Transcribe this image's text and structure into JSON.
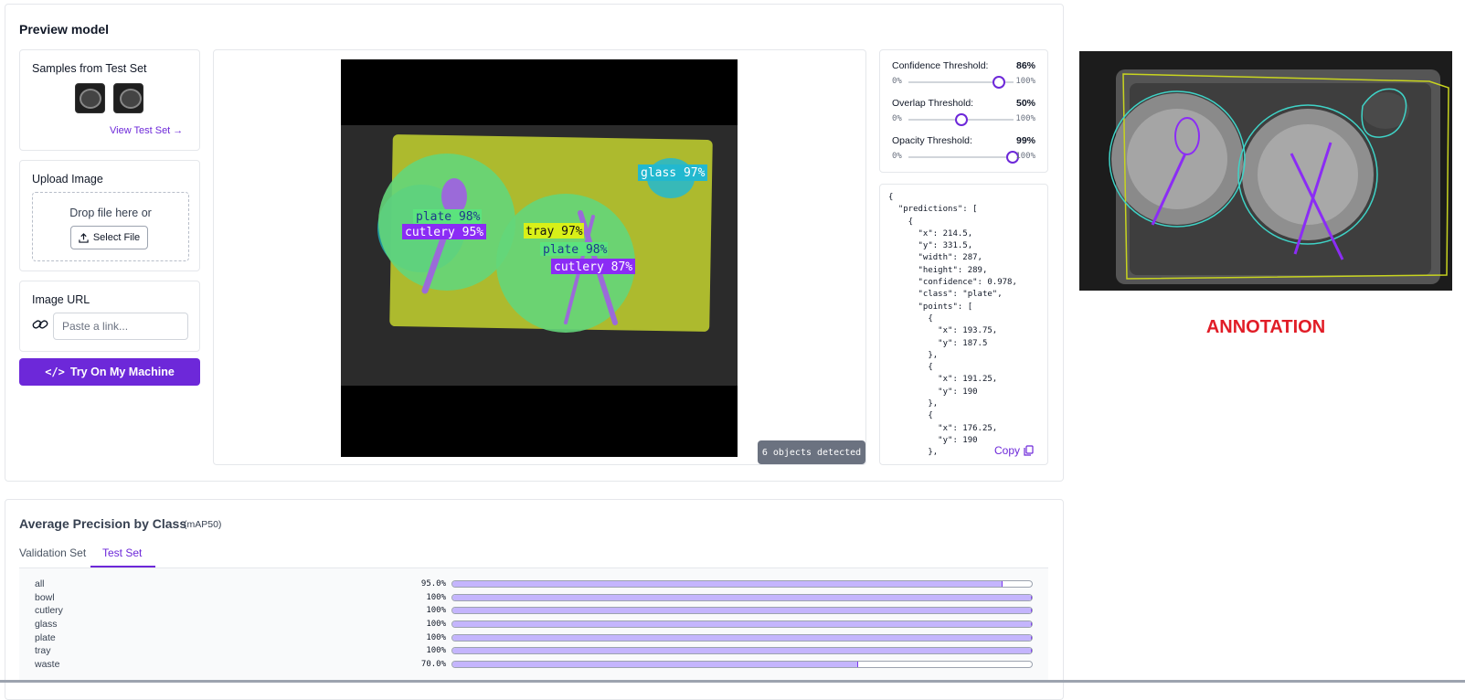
{
  "preview": {
    "title": "Preview model",
    "samples_label": "Samples from Test Set",
    "view_test_set": "View Test Set →",
    "upload_label": "Upload Image",
    "drop_text": "Drop file here or",
    "select_file": "Select File",
    "url_label": "Image URL",
    "url_placeholder": "Paste a link...",
    "try_button": "Try On My Machine",
    "objects_detected": "6 objects detected",
    "detections": [
      {
        "label": "glass 97%",
        "color": "#22b8cf"
      },
      {
        "label": "plate 98%",
        "color": "#5be37d"
      },
      {
        "label": "cutlery 95%",
        "color": "#8b2cf5"
      },
      {
        "label": "tray 97%",
        "color": "#d9f018"
      },
      {
        "label": "plate 98%",
        "color": "#5be37d"
      },
      {
        "label": "cutlery 87%",
        "color": "#8b2cf5"
      }
    ]
  },
  "thresholds": [
    {
      "label": "Confidence Threshold:",
      "value": "86%",
      "min": "0%",
      "max": "100%",
      "level": 0.86
    },
    {
      "label": "Overlap Threshold:",
      "value": "50%",
      "min": "0%",
      "max": "100%",
      "level": 0.5
    },
    {
      "label": "Opacity Threshold:",
      "value": "99%",
      "min": "0%",
      "max": "100%",
      "level": 0.99
    }
  ],
  "json_output": "{\n  \"predictions\": [\n    {\n      \"x\": 214.5,\n      \"y\": 331.5,\n      \"width\": 287,\n      \"height\": 289,\n      \"confidence\": 0.978,\n      \"class\": \"plate\",\n      \"points\": [\n        {\n          \"x\": 193.75,\n          \"y\": 187.5\n        },\n        {\n          \"x\": 191.25,\n          \"y\": 190\n        },\n        {\n          \"x\": 176.25,\n          \"y\": 190\n        },",
  "copy_label": "Copy",
  "annotation_label": "ANNOTATION",
  "ap": {
    "title": "Average Precision by Class",
    "subtitle": "(mAP50)",
    "tabs": [
      "Validation Set",
      "Test Set"
    ],
    "rows": [
      {
        "name": "all",
        "value": "95.0%",
        "fraction": 0.95
      },
      {
        "name": "bowl",
        "value": "100%",
        "fraction": 1.0
      },
      {
        "name": "cutlery",
        "value": "100%",
        "fraction": 1.0
      },
      {
        "name": "glass",
        "value": "100%",
        "fraction": 1.0
      },
      {
        "name": "plate",
        "value": "100%",
        "fraction": 1.0
      },
      {
        "name": "tray",
        "value": "100%",
        "fraction": 1.0
      },
      {
        "name": "waste",
        "value": "70.0%",
        "fraction": 0.7
      }
    ]
  },
  "colors": {
    "accent": "#6d28d9",
    "annotation_red": "#e11d27"
  }
}
